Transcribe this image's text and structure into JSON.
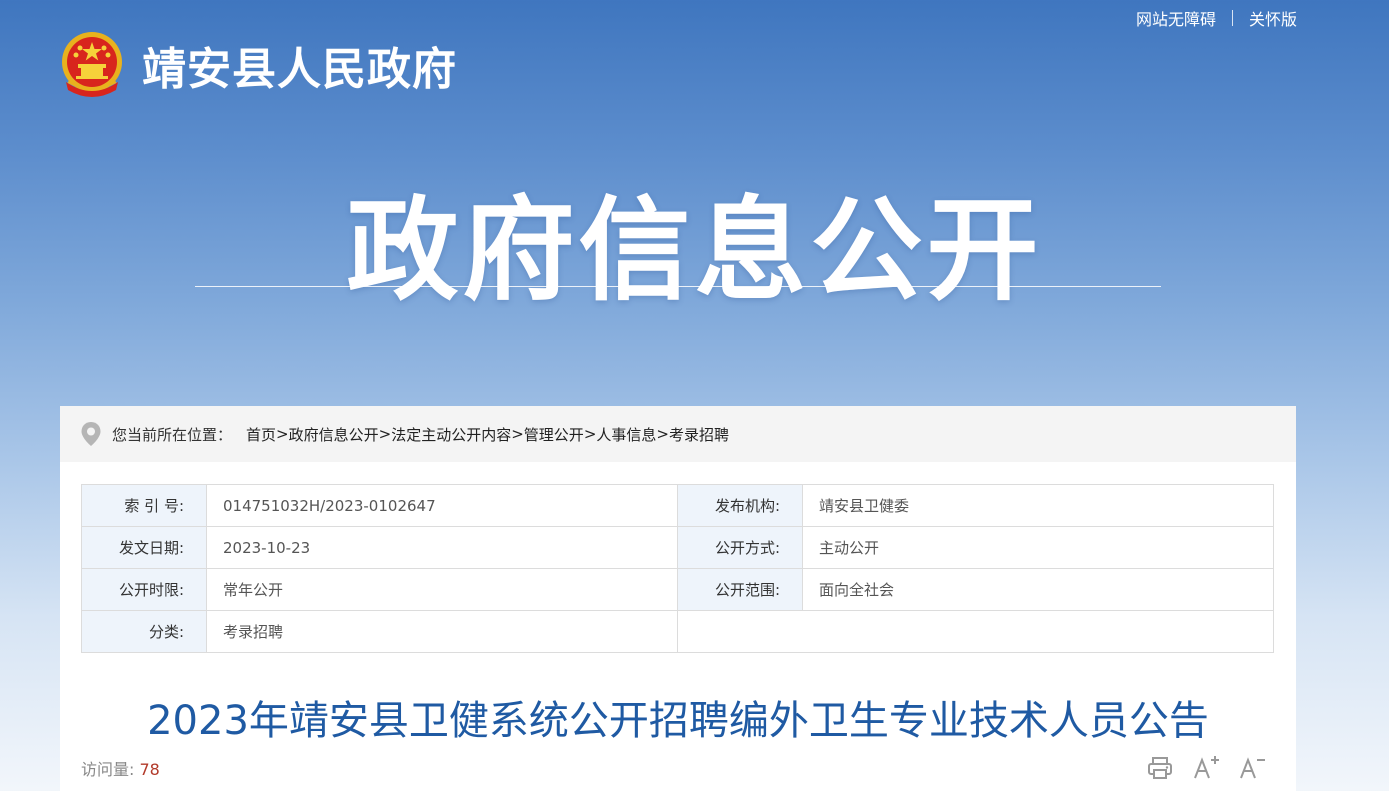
{
  "top_links": {
    "accessibility": "网站无障碍",
    "elder_mode": "关怀版"
  },
  "site": {
    "name": "靖安县人民政府"
  },
  "banner": {
    "title": "政府信息公开"
  },
  "breadcrumb": {
    "lead": "您当前所在位置：",
    "items": [
      "首页",
      "政府信息公开",
      "法定主动公开内容",
      "管理公开",
      "人事信息",
      "考录招聘"
    ],
    "separator": ">"
  },
  "meta": {
    "index_no_label": "索 引 号:",
    "index_no": "014751032H/2023-0102647",
    "publisher_label": "发布机构:",
    "publisher": "靖安县卫健委",
    "date_label": "发文日期:",
    "date": "2023-10-23",
    "disclosure_mode_label": "公开方式:",
    "disclosure_mode": "主动公开",
    "time_limit_label": "公开时限:",
    "time_limit": "常年公开",
    "scope_label": "公开范围:",
    "scope": "面向全社会",
    "category_label": "分类:",
    "category": "考录招聘"
  },
  "article": {
    "title": "2023年靖安县卫健系统公开招聘编外卫生专业技术人员公告",
    "views_label": "访问量:",
    "views": "78"
  },
  "icons": {
    "print": "print-icon",
    "font_increase": "font-increase-icon",
    "font_decrease": "font-decrease-icon",
    "location": "location-pin-icon",
    "emblem": "national-emblem-icon"
  },
  "colors": {
    "title_blue": "#1f5aa3",
    "label_bg": "#eef4fb",
    "views_num": "#b23a2a"
  }
}
